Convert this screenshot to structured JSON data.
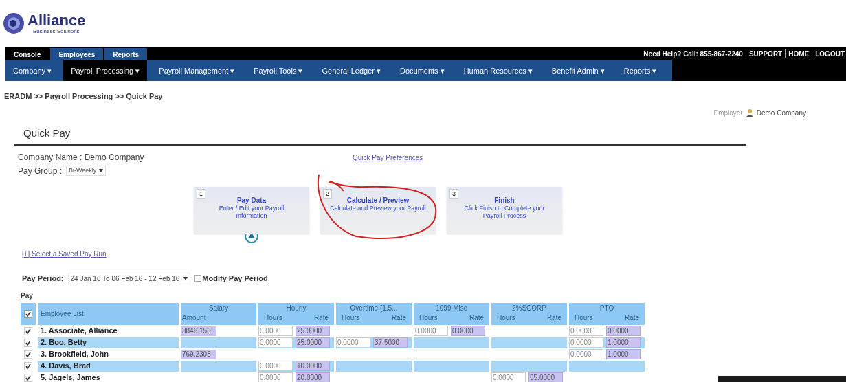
{
  "logo": {
    "name": "Alliance",
    "tagline": "Business Solutions"
  },
  "top_tabs": [
    {
      "label": "Console",
      "selected": true
    },
    {
      "label": "Employees",
      "selected": false
    },
    {
      "label": "Reports",
      "selected": false
    }
  ],
  "help": {
    "text": "Need Help? Call: 855-867-2240",
    "links": [
      "SUPPORT",
      "HOME",
      "LOGOUT"
    ]
  },
  "menu": [
    {
      "label": "Company ▾",
      "selected": false
    },
    {
      "label": "Payroll Processing ▾",
      "selected": true
    },
    {
      "label": "Payroll Management ▾",
      "selected": false
    },
    {
      "label": "Payroll Tools ▾",
      "selected": false
    },
    {
      "label": "General Ledger ▾",
      "selected": false
    },
    {
      "label": "Documents ▾",
      "selected": false
    },
    {
      "label": "Human Resources ▾",
      "selected": false
    },
    {
      "label": "Benefit Admin ▾",
      "selected": false
    },
    {
      "label": "Reports ▾",
      "selected": false
    }
  ],
  "breadcrumb": "ERADM >> Payroll Processing >> Quick Pay",
  "employer": {
    "label": "Employer",
    "name": "Demo Company"
  },
  "page_title": "Quick Pay",
  "company_name": "Company Name : Demo Company",
  "pay_group": {
    "label": "Pay Group :",
    "value": "Bi-Weekly"
  },
  "preferences_link": "Quick Pay Preferences",
  "steps": [
    {
      "number": "1",
      "title": "Pay Data",
      "description": "Enter / Edit your Payroll Information",
      "current": true
    },
    {
      "number": "2",
      "title": "Calculate / Preview",
      "description": "Calculate and Preview your Payroll",
      "current": false
    },
    {
      "number": "3",
      "title": "Finish",
      "description": "Click Finish to Complete your Payroll Process",
      "current": false
    }
  ],
  "saved_run_link": "[+] Select a Saved Pay Run",
  "pay_period": {
    "label": "Pay Period:",
    "value": "24 Jan 16 To 06 Feb 16 - 12 Feb 16",
    "modify_label": "Modify Pay Period",
    "modify_checked": false
  },
  "section": "Pay",
  "table": {
    "all_checked": true,
    "name_column": "Employee List",
    "salary": {
      "title": "Salary",
      "sub": "Amount"
    },
    "groups": [
      {
        "title": "Hourly",
        "hours": "Hours",
        "rate": "Rate"
      },
      {
        "title": "Overtime (1.5...",
        "hours": "Hours",
        "rate": "Rate"
      },
      {
        "title": "1099 Misc",
        "hours": "Hours",
        "rate": "Rate"
      },
      {
        "title": "2%SCORP",
        "hours": "Hours",
        "rate": "Rate"
      },
      {
        "title": "PTO",
        "hours": "Hours",
        "rate": "Rate"
      }
    ],
    "rows": [
      {
        "checked": true,
        "name": "1. Associate, Alliance",
        "salary": "3846.153",
        "cells": [
          [
            "0.0000",
            "25.0000"
          ],
          null,
          [
            "0.0000",
            "0.0000"
          ],
          null,
          [
            "0.0000",
            "0.0000"
          ]
        ]
      },
      {
        "checked": true,
        "name": "2. Boo, Betty",
        "cells": [
          [
            "0.0000",
            "25.0000"
          ],
          [
            "0.0000",
            "37.5000"
          ],
          null,
          null,
          [
            "0.0000",
            "1.0000"
          ]
        ]
      },
      {
        "checked": true,
        "name": "3. Brookfield, John",
        "salary": "769.2308",
        "cells": [
          null,
          null,
          null,
          null,
          [
            "0.0000",
            "1.0000"
          ]
        ]
      },
      {
        "checked": true,
        "name": "4. Davis, Brad",
        "cells": [
          [
            "0.0000",
            "10.0000"
          ],
          null,
          null,
          null,
          null
        ]
      },
      {
        "checked": true,
        "name": "5. Jagels, James",
        "cells": [
          [
            "0.0000",
            "20.0000"
          ],
          null,
          null,
          [
            "0.0000",
            "55.0000"
          ],
          null
        ]
      }
    ]
  }
}
